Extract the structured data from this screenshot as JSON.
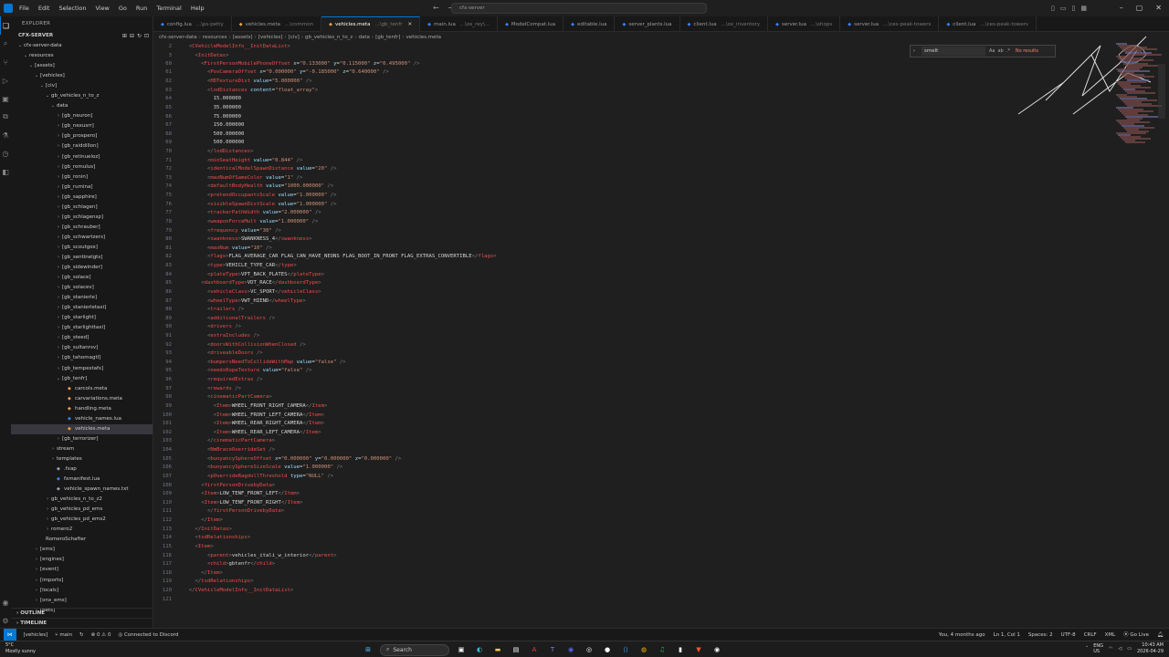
{
  "menu": [
    "File",
    "Edit",
    "Selection",
    "View",
    "Go",
    "Run",
    "Terminal",
    "Help"
  ],
  "command_center": "cfx-server",
  "sidebar": {
    "title": "EXPLORER",
    "root": "CFX-SERVER",
    "tree": [
      {
        "label": "cfx-server-data",
        "indent": 1,
        "chev": "v",
        "open": true
      },
      {
        "label": "resources",
        "indent": 2,
        "chev": "v",
        "open": true
      },
      {
        "label": "[assets]",
        "indent": 3,
        "chev": "v",
        "open": true
      },
      {
        "label": "[vehicles]",
        "indent": 4,
        "chev": "v",
        "open": true
      },
      {
        "label": "[civ]",
        "indent": 5,
        "chev": "v",
        "open": true
      },
      {
        "label": "gb_vehicles_n_to_z",
        "indent": 6,
        "chev": "v",
        "open": true
      },
      {
        "label": "data",
        "indent": 7,
        "chev": "v",
        "open": true
      },
      {
        "label": "[gb_neuron]",
        "indent": 8,
        "chev": ">"
      },
      {
        "label": "[gb_nexusrr]",
        "indent": 8,
        "chev": ">"
      },
      {
        "label": "[gb_prospero]",
        "indent": 8,
        "chev": ">"
      },
      {
        "label": "[gb_raiddillon]",
        "indent": 8,
        "chev": ">"
      },
      {
        "label": "[gb_retinueloz]",
        "indent": 8,
        "chev": ">"
      },
      {
        "label": "[gb_romulus]",
        "indent": 8,
        "chev": ">"
      },
      {
        "label": "[gb_ronin]",
        "indent": 8,
        "chev": ">"
      },
      {
        "label": "[gb_rumina]",
        "indent": 8,
        "chev": ">"
      },
      {
        "label": "[gb_sapphire]",
        "indent": 8,
        "chev": ">"
      },
      {
        "label": "[gb_schlagen]",
        "indent": 8,
        "chev": ">"
      },
      {
        "label": "[gb_schlagensp]",
        "indent": 8,
        "chev": ">"
      },
      {
        "label": "[gb_schrauber]",
        "indent": 8,
        "chev": ">"
      },
      {
        "label": "[gb_schwartzers]",
        "indent": 8,
        "chev": ">"
      },
      {
        "label": "[gb_scoutgox]",
        "indent": 8,
        "chev": ">"
      },
      {
        "label": "[gb_sentinelgts]",
        "indent": 8,
        "chev": ">"
      },
      {
        "label": "[gb_sidewinder]",
        "indent": 8,
        "chev": ">"
      },
      {
        "label": "[gb_solace]",
        "indent": 8,
        "chev": ">"
      },
      {
        "label": "[gb_solacev]",
        "indent": 8,
        "chev": ">"
      },
      {
        "label": "[gb_stanierle]",
        "indent": 8,
        "chev": ">"
      },
      {
        "label": "[gb_stanierletaxi]",
        "indent": 8,
        "chev": ">"
      },
      {
        "label": "[gb_starlight]",
        "indent": 8,
        "chev": ">"
      },
      {
        "label": "[gb_starlighttaxi]",
        "indent": 8,
        "chev": ">"
      },
      {
        "label": "[gb_steed]",
        "indent": 8,
        "chev": ">"
      },
      {
        "label": "[gb_sultanrsv]",
        "indent": 8,
        "chev": ">"
      },
      {
        "label": "[gb_tahomagtl]",
        "indent": 8,
        "chev": ">"
      },
      {
        "label": "[gb_tempestafs]",
        "indent": 8,
        "chev": ">"
      },
      {
        "label": "[gb_tenfr]",
        "indent": 8,
        "chev": "v",
        "open": true
      },
      {
        "label": "carcols.meta",
        "indent": 9,
        "chev": "",
        "file": true
      },
      {
        "label": "carvariations.meta",
        "indent": 9,
        "chev": "",
        "file": true
      },
      {
        "label": "handling.meta",
        "indent": 9,
        "chev": "",
        "file": true
      },
      {
        "label": "vehicle_names.lua",
        "indent": 9,
        "chev": "",
        "file": true
      },
      {
        "label": "vehicles.meta",
        "indent": 9,
        "chev": "",
        "file": true,
        "selected": true
      },
      {
        "label": "[gb_terrorizer]",
        "indent": 8,
        "chev": ">"
      },
      {
        "label": "stream",
        "indent": 7,
        "chev": ">"
      },
      {
        "label": "templates",
        "indent": 7,
        "chev": ">"
      },
      {
        "label": ".fxap",
        "indent": 7,
        "chev": "",
        "file": true
      },
      {
        "label": "fxmanifest.lua",
        "indent": 7,
        "chev": "",
        "file": true
      },
      {
        "label": "vehicle_spawn_names.txt",
        "indent": 7,
        "chev": "",
        "file": true
      },
      {
        "label": "gb_vehicles_n_to_z2",
        "indent": 6,
        "chev": ">"
      },
      {
        "label": "gb_vehicles_pd_ems",
        "indent": 6,
        "chev": ">"
      },
      {
        "label": "gb_vehicles_pd_ems2",
        "indent": 6,
        "chev": ">"
      },
      {
        "label": "romero2",
        "indent": 6,
        "chev": ">"
      },
      {
        "label": "RomeroSchafter",
        "indent": 5,
        "chev": ""
      },
      {
        "label": "[ems]",
        "indent": 4,
        "chev": ">"
      },
      {
        "label": "[engines]",
        "indent": 4,
        "chev": ">"
      },
      {
        "label": "[event]",
        "indent": 4,
        "chev": ">"
      },
      {
        "label": "[imports]",
        "indent": 4,
        "chev": ">"
      },
      {
        "label": "[locals]",
        "indent": 4,
        "chev": ">"
      },
      {
        "label": "[onx_ems]",
        "indent": 4,
        "chev": ">"
      },
      {
        "label": "[pets]",
        "indent": 4,
        "chev": ">"
      }
    ],
    "outline": "OUTLINE",
    "timeline": "TIMELINE"
  },
  "tabs": [
    {
      "label": "config.lua",
      "desc": "...\\ps-petty",
      "active": false
    },
    {
      "label": "vehicles.meta",
      "desc": "...\\common",
      "active": false
    },
    {
      "label": "vehicles.meta",
      "desc": "...\\gb_tenfr",
      "active": true
    },
    {
      "label": "main.lua",
      "desc": "...\\ox_rey\\...",
      "active": false
    },
    {
      "label": "ModelCompat.lua",
      "desc": "",
      "active": false
    },
    {
      "label": "editable.lua",
      "desc": "",
      "active": false
    },
    {
      "label": "server_plants.lua",
      "desc": "",
      "active": false
    },
    {
      "label": "client.lua",
      "desc": "...\\ox_inventory",
      "active": false
    },
    {
      "label": "server.lua",
      "desc": "...\\shops",
      "active": false
    },
    {
      "label": "server.lua",
      "desc": "...\\ces-peak-towers",
      "active": false
    },
    {
      "label": "client.lua",
      "desc": "...\\ces-peak-towers",
      "active": false
    }
  ],
  "breadcrumb": [
    "cfx-server-data",
    "resources",
    "[assets]",
    "[vehicles]",
    "[civ]",
    "gb_vehicles_n_to_z",
    "data",
    "[gb_tenfr]",
    "vehicles.meta"
  ],
  "find": {
    "query": "smelt",
    "result": "No results"
  },
  "code": {
    "first_line": "  <CVehicleModelInfo__InitDataList>",
    "lines": [
      {
        "n": "2",
        "t": "  <CVehicleModelInfo__InitDataList>"
      },
      {
        "n": "3",
        "t": "    <InitDatas>"
      },
      {
        "n": "60",
        "t": "      <FirstPersonMobilePhoneOffset x=\"0.133000\" y=\"0.115000\" z=\"0.495000\" />"
      },
      {
        "n": "61",
        "t": "        <PovCameraOffset x=\"0.000000\" y=\"-0.185000\" z=\"0.640000\" />"
      },
      {
        "n": "62",
        "t": "        <HDTextureDist value=\"5.000000\" />"
      },
      {
        "n": "63",
        "t": "        <lodDistances content=\"float_array\">"
      },
      {
        "n": "64",
        "t": "          15.000000"
      },
      {
        "n": "65",
        "t": "          35.000000"
      },
      {
        "n": "66",
        "t": "          75.000000"
      },
      {
        "n": "67",
        "t": "          150.000000"
      },
      {
        "n": "68",
        "t": "          500.000000"
      },
      {
        "n": "69",
        "t": "          500.000000"
      },
      {
        "n": "70",
        "t": "        </lodDistances>"
      },
      {
        "n": "71",
        "t": "        <minSeatHeight value=\"0.844\" />"
      },
      {
        "n": "72",
        "t": "        <identicalModelSpawnDistance value=\"20\" />"
      },
      {
        "n": "73",
        "t": "        <maxNumOfSameColor value=\"1\" />"
      },
      {
        "n": "74",
        "t": "        <defaultBodyHealth value=\"1000.000000\" />"
      },
      {
        "n": "75",
        "t": "        <pretendOccupantsScale value=\"1.000000\" />"
      },
      {
        "n": "76",
        "t": "        <visibleSpawnDistScale value=\"1.000000\" />"
      },
      {
        "n": "77",
        "t": "        <trackerPathWidth value=\"2.000000\" />"
      },
      {
        "n": "78",
        "t": "        <weaponForceMult value=\"1.000000\" />"
      },
      {
        "n": "79",
        "t": "        <frequency value=\"30\" />"
      },
      {
        "n": "80",
        "t": "        <swankness>SWANKNESS_4</swankness>"
      },
      {
        "n": "81",
        "t": "        <maxNum value=\"10\" />"
      },
      {
        "n": "82",
        "t": "        <flags>FLAG_AVERAGE_CAR FLAG_CAN_HAVE_NEONS FLAG_BOOT_IN_FRONT FLAG_EXTRAS_CONVERTIBLE</flags>"
      },
      {
        "n": "83",
        "t": "        <type>VEHICLE_TYPE_CAR</type>"
      },
      {
        "n": "84",
        "t": "        <plateType>VPT_BACK_PLATES</plateType>"
      },
      {
        "n": "85",
        "t": "      <dashboardType>VDT_RACE</dashboardType>"
      },
      {
        "n": "86",
        "t": "        <vehicleClass>VC_SPORT</vehicleClass>"
      },
      {
        "n": "87",
        "t": "        <wheelType>VWT_HIEND</wheelType>"
      },
      {
        "n": "88",
        "t": "        <trailers />"
      },
      {
        "n": "89",
        "t": "        <additionalTrailers />"
      },
      {
        "n": "90",
        "t": "        <drivers />"
      },
      {
        "n": "91",
        "t": "        <extraIncludes />"
      },
      {
        "n": "92",
        "t": "        <doorsWithCollisionWhenClosed />"
      },
      {
        "n": "93",
        "t": "        <driveableDoors />"
      },
      {
        "n": "94",
        "t": "        <bumpersNeedToCollideWithMap value=\"false\" />"
      },
      {
        "n": "95",
        "t": "        <needsRopeTexture value=\"false\" />"
      },
      {
        "n": "96",
        "t": "        <requiredExtras />"
      },
      {
        "n": "97",
        "t": "        <rewards />"
      },
      {
        "n": "98",
        "t": "        <cinematicPartCamera>"
      },
      {
        "n": "99",
        "t": "          <Item>WHEEL_FRONT_RIGHT_CAMERA</Item>"
      },
      {
        "n": "100",
        "t": "          <Item>WHEEL_FRONT_LEFT_CAMERA</Item>"
      },
      {
        "n": "101",
        "t": "          <Item>WHEEL_REAR_RIGHT_CAMERA</Item>"
      },
      {
        "n": "102",
        "t": "          <Item>WHEEL_REAR_LEFT_CAMERA</Item>"
      },
      {
        "n": "103",
        "t": "        </cinematicPartCamera>"
      },
      {
        "n": "104",
        "t": "        <NmBraceOverrideSet />"
      },
      {
        "n": "105",
        "t": "        <buoyancySphereOffset x=\"0.000000\" y=\"0.000000\" z=\"0.000000\" />"
      },
      {
        "n": "106",
        "t": "        <buoyancySphereSizeScale value=\"1.000000\" />"
      },
      {
        "n": "107",
        "t": "        <pOverrideRagdollThreshold type=\"NULL\" />"
      },
      {
        "n": "108",
        "t": "      <firstPersonDrivebyData>"
      },
      {
        "n": "109",
        "t": "      <Item>LOW_TENF_FRONT_LEFT</Item>"
      },
      {
        "n": "110",
        "t": "      <Item>LOW_TENF_FRONT_RIGHT</Item>"
      },
      {
        "n": "111",
        "t": "        </firstPersonDrivebyData>"
      },
      {
        "n": "112",
        "t": "      </Item>"
      },
      {
        "n": "113",
        "t": "    </InitDatas>"
      },
      {
        "n": "114",
        "t": "    <txdRelationships>"
      },
      {
        "n": "115",
        "t": "    <Item>"
      },
      {
        "n": "116",
        "t": "        <parent>vehicles_itali_w_interior</parent>"
      },
      {
        "n": "117",
        "t": "        <child>gbtenfr</child>"
      },
      {
        "n": "118",
        "t": "      </Item>"
      },
      {
        "n": "119",
        "t": "    </txdRelationships>"
      },
      {
        "n": "120",
        "t": "  </CVehicleModelInfo__InitDataList>"
      },
      {
        "n": "121",
        "t": ""
      }
    ]
  },
  "statusbar": {
    "branch_folder": "[vehicles]",
    "branch": "main",
    "errors": "0",
    "warnings": "0",
    "discord": "Connected to Discord",
    "blame": "You, 4 months ago",
    "position": "Ln 1, Col 1",
    "spaces": "Spaces: 2",
    "encoding": "UTF-8",
    "eol": "CRLF",
    "language": "XML",
    "golive": "Go Live"
  },
  "taskbar": {
    "temp": "5°C",
    "weather": "Mostly sunny",
    "search": "Search",
    "lang": "ENG",
    "region": "US",
    "time": "10:43 AM",
    "date": "2026-04-29"
  },
  "colors": {
    "accent": "#0078d4",
    "tag": "#f14c4c",
    "attr": "#9cdcfe",
    "string": "#ce9178"
  }
}
